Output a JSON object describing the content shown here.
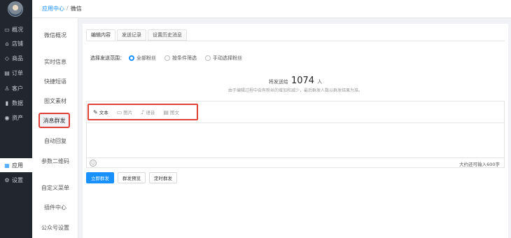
{
  "sidebar": {
    "items": [
      {
        "icon": "overview-icon",
        "glyph": "▭",
        "label": "概况"
      },
      {
        "icon": "store-icon",
        "glyph": "⌂",
        "label": "店铺"
      },
      {
        "icon": "tag-icon",
        "glyph": "◇",
        "label": "商品"
      },
      {
        "icon": "order-icon",
        "glyph": "▤",
        "label": "订单"
      },
      {
        "icon": "customer-icon",
        "glyph": "♙",
        "label": "客户"
      },
      {
        "icon": "data-icon",
        "glyph": "▮",
        "label": "数据"
      },
      {
        "icon": "asset-icon",
        "glyph": "◉",
        "label": "资产"
      },
      {
        "icon": "apps-icon",
        "glyph": "▦",
        "label": "应用"
      },
      {
        "icon": "settings-icon",
        "glyph": "⚙",
        "label": "设置"
      }
    ]
  },
  "breadcrumb": {
    "link": "应用中心",
    "separator": "/",
    "current": "微信"
  },
  "subnav": {
    "items": [
      "微信概况",
      "实时信息",
      "快捷短语",
      "图文素材",
      "消息群发",
      "自动回复",
      "参数二维码",
      "自定义菜单",
      "插件中心",
      "公众号设置"
    ]
  },
  "tabs": [
    "编辑内容",
    "发送记录",
    "设置历史消息"
  ],
  "scope": {
    "label": "选择发送范围：",
    "options": [
      "全部粉丝",
      "按条件筛选",
      "手动选择粉丝"
    ]
  },
  "count": {
    "prefix": "将发送给",
    "number": "1074",
    "suffix": "人",
    "note": "由于编辑过程中会有粉丝的增加和减少，最后群发人数以群发结果为准。"
  },
  "editor": {
    "tools": [
      {
        "icon": "pencil-icon",
        "glyph": "✎",
        "label": "文本"
      },
      {
        "icon": "image-icon",
        "glyph": "▭",
        "label": "图片"
      },
      {
        "icon": "mic-icon",
        "glyph": "♪",
        "label": "语音"
      },
      {
        "icon": "article-icon",
        "glyph": "▤",
        "label": "图文"
      }
    ],
    "emoji_glyph": "☺",
    "remaining": "大约还可输入600字"
  },
  "buttons": {
    "send_now": "立即群发",
    "preview": "群发预览",
    "scheduled": "定时群发"
  },
  "colors": {
    "accent": "#1890ff",
    "highlight": "#e0403a",
    "sidebar_bg": "#22262e"
  }
}
